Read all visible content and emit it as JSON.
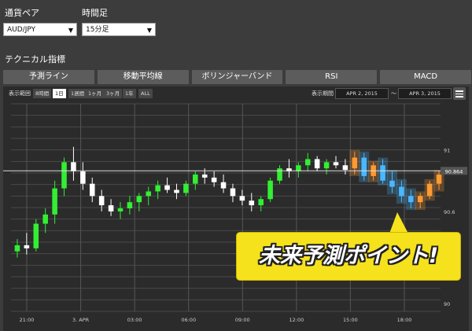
{
  "controls": {
    "pair_label": "通貨ペア",
    "pair_value": "AUD/JPY",
    "timeframe_label": "時間足",
    "timeframe_value": "15分足",
    "technical_label": "テクニカル指標"
  },
  "tabs": [
    "予測ライン",
    "移動平均線",
    "ボリンジャーバンド",
    "RSI",
    "MACD"
  ],
  "toolbar": {
    "range_label": "表示範囲",
    "ranges": [
      "8時間",
      "1日",
      "1週間",
      "1ヶ月",
      "3ヶ月",
      "1年",
      "ALL"
    ],
    "active_range": "1日",
    "period_label": "表示期間",
    "date_from": "APR 2, 2015",
    "date_sep": "〜",
    "date_to": "APR 3, 2015"
  },
  "chart_data": {
    "type": "candlestick",
    "x_ticks": [
      "21:00",
      "3. APR",
      "03:00",
      "06:00",
      "09:00",
      "12:00",
      "15:00",
      "18:00"
    ],
    "y_ticks": [
      91,
      90.6,
      90.2,
      90
    ],
    "ylim": [
      89.95,
      91.3
    ],
    "current_price": "90.864",
    "grid": true,
    "colors": {
      "up": "#33ee33",
      "down": "#ffffff",
      "forecast_up": "#ff9a33",
      "forecast_down": "#4ab8ff",
      "price_line": "#dddddd"
    },
    "candles": [
      [
        90.34,
        90.42,
        90.3,
        90.38
      ],
      [
        90.38,
        90.46,
        90.32,
        90.36
      ],
      [
        90.36,
        90.55,
        90.34,
        90.52
      ],
      [
        90.52,
        90.62,
        90.46,
        90.58
      ],
      [
        90.58,
        90.8,
        90.52,
        90.75
      ],
      [
        90.75,
        90.95,
        90.7,
        90.92
      ],
      [
        90.92,
        91.02,
        90.8,
        90.86
      ],
      [
        90.86,
        90.92,
        90.74,
        90.78
      ],
      [
        90.78,
        90.82,
        90.66,
        90.7
      ],
      [
        90.7,
        90.74,
        90.6,
        90.64
      ],
      [
        90.64,
        90.68,
        90.57,
        90.6
      ],
      [
        90.6,
        90.66,
        90.55,
        90.62
      ],
      [
        90.62,
        90.7,
        90.58,
        90.66
      ],
      [
        90.66,
        90.72,
        90.6,
        90.7
      ],
      [
        90.7,
        90.76,
        90.64,
        90.73
      ],
      [
        90.73,
        90.8,
        90.68,
        90.77
      ],
      [
        90.77,
        90.82,
        90.72,
        90.74
      ],
      [
        90.74,
        90.78,
        90.68,
        90.72
      ],
      [
        90.72,
        90.8,
        90.7,
        90.78
      ],
      [
        90.78,
        90.86,
        90.74,
        90.84
      ],
      [
        90.84,
        90.88,
        90.78,
        90.82
      ],
      [
        90.82,
        90.86,
        90.76,
        90.79
      ],
      [
        90.79,
        90.84,
        90.72,
        90.75
      ],
      [
        90.75,
        90.78,
        90.66,
        90.7
      ],
      [
        90.7,
        90.74,
        90.64,
        90.67
      ],
      [
        90.67,
        90.72,
        90.6,
        90.64
      ],
      [
        90.64,
        90.7,
        90.6,
        90.68
      ],
      [
        90.68,
        90.82,
        90.66,
        90.8
      ],
      [
        90.8,
        90.9,
        90.78,
        90.88
      ],
      [
        90.88,
        90.94,
        90.82,
        90.86
      ],
      [
        90.86,
        90.92,
        90.82,
        90.9
      ],
      [
        90.9,
        90.98,
        90.86,
        90.94
      ],
      [
        90.94,
        90.96,
        90.86,
        90.88
      ],
      [
        90.88,
        90.94,
        90.84,
        90.92
      ],
      [
        90.92,
        90.96,
        90.88,
        90.9
      ],
      [
        90.9,
        90.94,
        90.84,
        90.87
      ]
    ],
    "forecast": [
      [
        90.88,
        90.99,
        90.84,
        90.95
      ],
      [
        90.95,
        90.98,
        90.8,
        90.83
      ],
      [
        90.83,
        90.92,
        90.8,
        90.9
      ],
      [
        90.9,
        90.94,
        90.78,
        90.8
      ],
      [
        90.8,
        90.86,
        90.72,
        90.76
      ],
      [
        90.76,
        90.8,
        90.66,
        90.7
      ],
      [
        90.7,
        90.74,
        90.62,
        90.66
      ],
      [
        90.66,
        90.72,
        90.62,
        90.7
      ],
      [
        90.7,
        90.8,
        90.68,
        90.78
      ],
      [
        90.78,
        90.86,
        90.74,
        90.84
      ]
    ]
  },
  "callout": {
    "text": "未来予測ポイント!"
  }
}
